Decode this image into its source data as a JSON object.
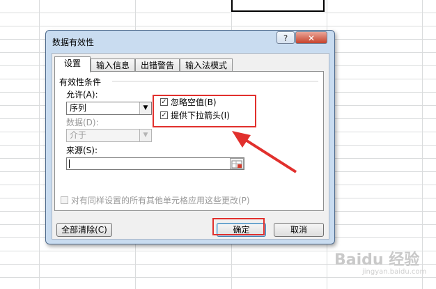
{
  "dialog": {
    "title": "数据有效性",
    "help_label": "?",
    "close_label": "✕"
  },
  "tabs": [
    {
      "label": "设置",
      "active": true
    },
    {
      "label": "输入信息",
      "active": false
    },
    {
      "label": "出错警告",
      "active": false
    },
    {
      "label": "输入法模式",
      "active": false
    }
  ],
  "settings": {
    "section_title": "有效性条件",
    "allow_label": "允许(A):",
    "allow_value": "序列",
    "data_label": "数据(D):",
    "data_value": "介于",
    "ignore_blank_label": "忽略空值(B)",
    "ignore_blank_checked": true,
    "dropdown_label": "提供下拉箭头(I)",
    "dropdown_checked": true,
    "source_label": "来源(S):",
    "source_value": "",
    "apply_all_label": "对有同样设置的所有其他单元格应用这些更改(P)",
    "apply_all_checked": false
  },
  "buttons": {
    "clear_all": "全部清除(C)",
    "ok": "确定",
    "cancel": "取消"
  },
  "watermark": {
    "text": "Baidu 经验",
    "sub": "jingyan.baidu.com"
  },
  "colors": {
    "highlight": "#e1302d",
    "dialog_frame": "#c9dcf0"
  }
}
